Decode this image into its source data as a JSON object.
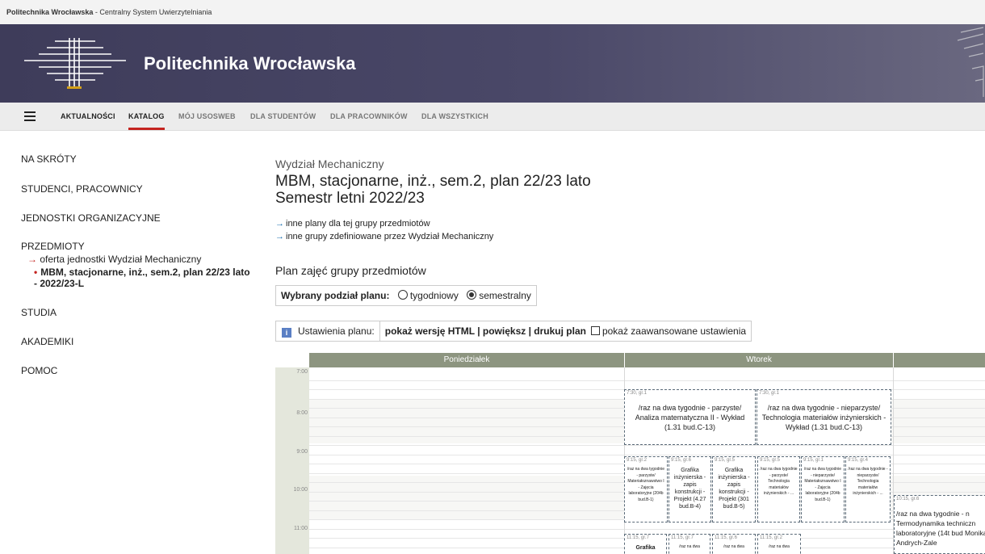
{
  "top": {
    "institution": "Politechnika Wrocławska",
    "system": " - Centralny System Uwierzytelniania"
  },
  "banner": {
    "title": "Politechnika Wrocławska"
  },
  "nav": {
    "menu_icon": "hamburger-icon",
    "items": [
      "AKTUALNOŚCI",
      "KATALOG",
      "MÓJ USOSWEB",
      "DLA STUDENTÓW",
      "DLA PRACOWNIKÓW",
      "DLA WSZYSTKICH"
    ],
    "active": "KATALOG"
  },
  "sidebar": {
    "na_skroty": "NA SKRÓTY",
    "studenci": "STUDENCI, PRACOWNICY",
    "jednostki": "JEDNOSTKI ORGANIZACYJNE",
    "przedmioty": "PRZEDMIOTY",
    "oferta": "oferta jednostki Wydział Mechaniczny",
    "current": "MBM, stacjonarne, inż., sem.2, plan 22/23 lato - 2022/23-L",
    "studia": "STUDIA",
    "akademiki": "AKADEMIKI",
    "pomoc": "POMOC"
  },
  "main": {
    "department": "Wydział Mechaniczny",
    "title_line1": "MBM, stacjonarne, inż., sem.2, plan 22/23 lato",
    "title_line2": "Semestr letni 2022/23",
    "link1": "inne plany dla tej grupy przedmiotów",
    "link2": "inne grupy zdefiniowane przez Wydział Mechaniczny",
    "section_title": "Plan zajęć grupy przedmiotów",
    "podzial_label": "Wybrany podział planu:",
    "opt_weekly": "tygodniowy",
    "opt_semester": "semestralny",
    "selected": "semestralny",
    "settings_label": "Ustawienia planu:",
    "settings_links": "pokaż wersję HTML | powiększ | drukuj plan",
    "advanced": "pokaż zaawansowane ustawienia"
  },
  "timetable": {
    "days": [
      "Poniedziałek",
      "Wtorek"
    ],
    "times": [
      "7:00",
      "8:00",
      "9:00",
      "10:00",
      "11:00"
    ],
    "classes": {
      "c1": {
        "code": "7:30, gr.1",
        "text": "/raz na dwa tygodnie - parzyste/ Analiza matematyczna II - Wykład (1.31 bud.C-13)"
      },
      "c2": {
        "code": "7:30, gr.1",
        "text": "/raz na dwa tygodnie - nieparzyste/ Technologia materiałów inżynierskich - Wykład (1.31 bud.C-13)"
      },
      "c3": {
        "code": "9:15, gr.2",
        "text": "/raz na dwa tygodnie - parzyste/ Materiałoznawstwo I - Zajęcia laboratoryjne (204b bud.B-1)"
      },
      "c4": {
        "code": "9:15, gr.6",
        "text": "Grafika inżynierska - zapis konstrukcji - Projekt (4.27 bud.B-4)"
      },
      "c5": {
        "code": "9:15, gr.5",
        "text": "Grafika inżynierska - zapis konstrukcji - Projekt (301 bud.B-5)"
      },
      "c6": {
        "code": "9:15, gr.5",
        "text": "/raz na dwa tygodnie - parzyste/ Technologia materiałów inżynierskich - ..."
      },
      "c7": {
        "code": "9:15, gr.1",
        "text": "/raz na dwa tygodnie - nieparzyste/ Materiałoznawstwo I - Zajęcia laboratoryjne (204b bud.B-1)"
      },
      "c8": {
        "code": "9:15, gr.4",
        "text": "/raz na dwa tygodnie - nieparzyste/ Technologia materiałów inżynierskich - ..."
      },
      "c9": {
        "code": "10:15, gr.6",
        "text": "/raz na dwa tygodnie - n Termodynamika techniczn laboratoryjne (14t bud Monika Andrych-Zale"
      },
      "c10": {
        "code": "11:15, gr.7",
        "text": "Grafika"
      },
      "c11": {
        "code": "11:15, gr.7",
        "text": "/raz na dwa"
      },
      "c12": {
        "code": "11:15, gr.6",
        "text": "/raz na dwa"
      },
      "c13": {
        "code": "11:15, gr.2",
        "text": "/raz na dwa"
      }
    }
  }
}
